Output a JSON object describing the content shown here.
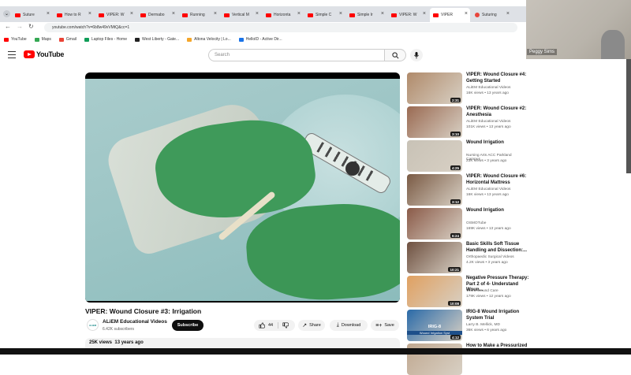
{
  "browser": {
    "tabs": [
      {
        "label": "Suture"
      },
      {
        "label": "How to R"
      },
      {
        "label": "VIPER: W"
      },
      {
        "label": "Dermabo"
      },
      {
        "label": "Running"
      },
      {
        "label": "Vertical M"
      },
      {
        "label": "Horizonta"
      },
      {
        "label": "Simple C"
      },
      {
        "label": "Simple Ir"
      },
      {
        "label": "VIPER: W"
      },
      {
        "label": "VIPER"
      },
      {
        "label": "Suturing"
      }
    ],
    "url": "youtube.com/watch?v=6b8w49vVMtQ&cc=1",
    "bookmarks": [
      {
        "label": "YouTube",
        "color": "#ff0000"
      },
      {
        "label": "Maps",
        "color": "#34a853"
      },
      {
        "label": "Gmail",
        "color": "#ea4335"
      },
      {
        "label": "Laptop Files - Home",
        "color": "#0f9d58"
      },
      {
        "label": "West Liberty - Gate...",
        "color": "#222222"
      },
      {
        "label": "Altona Velocity | Lo...",
        "color": "#f4a62a"
      },
      {
        "label": "HelloID - Active Dir...",
        "color": "#1a73e8"
      }
    ]
  },
  "webcam": {
    "name": "Peggy Sims"
  },
  "youtube": {
    "logo_text": "YouTube",
    "search_placeholder": "Search"
  },
  "video": {
    "title": "VIPER: Wound Closure #3: Irrigation",
    "channel": "ALiEM Educational Videos",
    "channel_avatar": "ALiEM",
    "subscribers": "6.42K subscribers",
    "subscribe_label": "Subscribe",
    "likes": "44",
    "share_label": "Share",
    "download_label": "Download",
    "save_label": "Save",
    "views": "25K views",
    "age": "13 years ago"
  },
  "recommendations": [
    {
      "title": "VIPER: Wound Closure #4: Getting Started",
      "channel": "ALiEM Educational Videos",
      "stats": "16K views • 13 years ago",
      "duration": "2:31",
      "thumb": "#b08a6a"
    },
    {
      "title": "VIPER: Wound Closure #2: Anesthesia",
      "channel": "ALiEM Educational Videos",
      "stats": "101K views • 13 years ago",
      "duration": "3:10",
      "thumb": "#9a6a52"
    },
    {
      "title": "Wound Irrigation",
      "channel": "Nursing Arts ACC Parkland Campus",
      "stats": "23K views • 3 years ago",
      "duration": "4:25",
      "thumb": "#c8c2b6"
    },
    {
      "title": "VIPER: Wound Closure #6: Horizontal Mattress",
      "channel": "ALiEM Educational Videos",
      "stats": "16K views • 13 years ago",
      "duration": "3:12",
      "thumb": "#7a5a44"
    },
    {
      "title": "Wound Irrigation",
      "channel": "OSMOTube",
      "stats": "169K views • 13 years ago",
      "duration": "6:24",
      "thumb": "#8a5a48"
    },
    {
      "title": "Basic Skills Soft Tissue Handling and Dissection:...",
      "channel": "Orthopaedic Surgical Videos",
      "stats": "4.2K views • 3 years ago",
      "duration": "10:21",
      "thumb": "#6e5040"
    },
    {
      "title": "Negative Pressure Therapy: Part 2 of 4- Understand Woun...",
      "channel": "Vohra Wound Care",
      "stats": "179K views • 12 years ago",
      "duration": "10:08",
      "thumb": "#e0a060"
    },
    {
      "title": "IRIG-8 Wound Irrigation System Trial",
      "channel": "Larry B. Mellick, MD",
      "stats": "36K views • 6 years ago",
      "duration": "4:12",
      "thumb": "#2a6aa8",
      "label": "IRIG-8",
      "sublabel": "Wound Irrigation Syst"
    },
    {
      "title": "How to Make a Pressurized",
      "channel": "",
      "stats": "",
      "duration": "",
      "thumb": "#c0a890"
    }
  ]
}
